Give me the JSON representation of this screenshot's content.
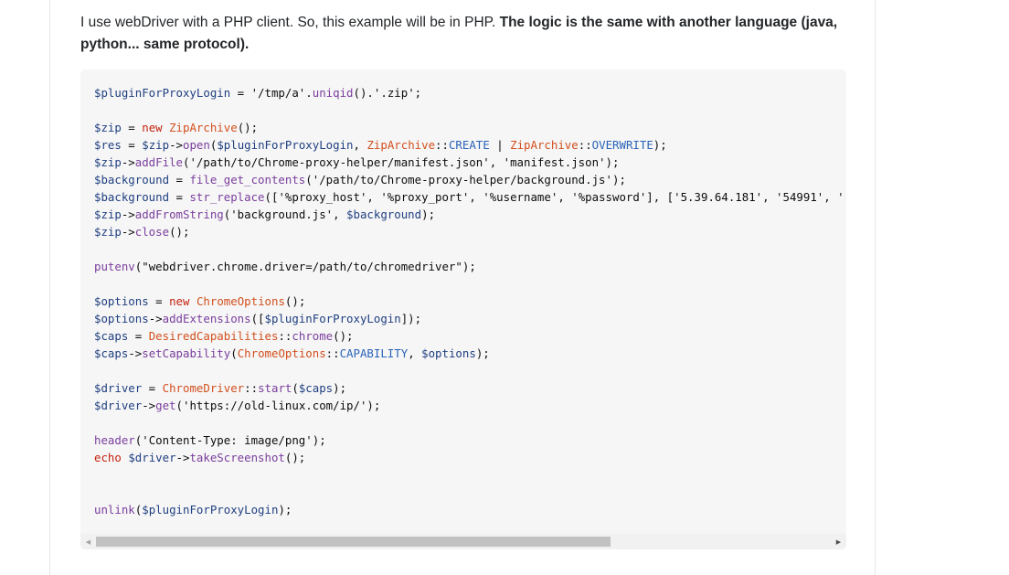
{
  "intro": {
    "plain": "I use webDriver with a PHP client. So, this example will be in PHP. ",
    "bold": "The logic is the same with another language (java, python... same protocol)."
  },
  "code": {
    "language": "php",
    "lines": [
      [
        {
          "t": "var",
          "v": "$pluginForProxyLogin"
        },
        {
          "t": "op",
          "v": " = "
        },
        {
          "t": "str",
          "v": "'/tmp/a'"
        },
        {
          "t": "op",
          "v": "."
        },
        {
          "t": "fn",
          "v": "uniqid"
        },
        {
          "t": "op",
          "v": "()."
        },
        {
          "t": "str",
          "v": "'.zip'"
        },
        {
          "t": "op",
          "v": ";"
        }
      ],
      [],
      [
        {
          "t": "var",
          "v": "$zip"
        },
        {
          "t": "op",
          "v": " = "
        },
        {
          "t": "kw",
          "v": "new"
        },
        {
          "t": "op",
          "v": " "
        },
        {
          "t": "cls",
          "v": "ZipArchive"
        },
        {
          "t": "op",
          "v": "();"
        }
      ],
      [
        {
          "t": "var",
          "v": "$res"
        },
        {
          "t": "op",
          "v": " = "
        },
        {
          "t": "var",
          "v": "$zip"
        },
        {
          "t": "op",
          "v": "->"
        },
        {
          "t": "fn",
          "v": "open"
        },
        {
          "t": "op",
          "v": "("
        },
        {
          "t": "var",
          "v": "$pluginForProxyLogin"
        },
        {
          "t": "op",
          "v": ", "
        },
        {
          "t": "cls",
          "v": "ZipArchive"
        },
        {
          "t": "op",
          "v": "::"
        },
        {
          "t": "const",
          "v": "CREATE"
        },
        {
          "t": "op",
          "v": " | "
        },
        {
          "t": "cls",
          "v": "ZipArchive"
        },
        {
          "t": "op",
          "v": "::"
        },
        {
          "t": "const",
          "v": "OVERWRITE"
        },
        {
          "t": "op",
          "v": ");"
        }
      ],
      [
        {
          "t": "var",
          "v": "$zip"
        },
        {
          "t": "op",
          "v": "->"
        },
        {
          "t": "fn",
          "v": "addFile"
        },
        {
          "t": "op",
          "v": "("
        },
        {
          "t": "str",
          "v": "'/path/to/Chrome-proxy-helper/manifest.json'"
        },
        {
          "t": "op",
          "v": ", "
        },
        {
          "t": "str",
          "v": "'manifest.json'"
        },
        {
          "t": "op",
          "v": ");"
        }
      ],
      [
        {
          "t": "var",
          "v": "$background"
        },
        {
          "t": "op",
          "v": " = "
        },
        {
          "t": "fn",
          "v": "file_get_contents"
        },
        {
          "t": "op",
          "v": "("
        },
        {
          "t": "str",
          "v": "'/path/to/Chrome-proxy-helper/background.js'"
        },
        {
          "t": "op",
          "v": ");"
        }
      ],
      [
        {
          "t": "var",
          "v": "$background"
        },
        {
          "t": "op",
          "v": " = "
        },
        {
          "t": "fn",
          "v": "str_replace"
        },
        {
          "t": "op",
          "v": "(["
        },
        {
          "t": "str",
          "v": "'%proxy_host'"
        },
        {
          "t": "op",
          "v": ", "
        },
        {
          "t": "str",
          "v": "'%proxy_port'"
        },
        {
          "t": "op",
          "v": ", "
        },
        {
          "t": "str",
          "v": "'%username'"
        },
        {
          "t": "op",
          "v": ", "
        },
        {
          "t": "str",
          "v": "'%password'"
        },
        {
          "t": "op",
          "v": "], ["
        },
        {
          "t": "str",
          "v": "'5.39.64.181'"
        },
        {
          "t": "op",
          "v": ", "
        },
        {
          "t": "str",
          "v": "'54991'"
        },
        {
          "t": "op",
          "v": ", '"
        }
      ],
      [
        {
          "t": "var",
          "v": "$zip"
        },
        {
          "t": "op",
          "v": "->"
        },
        {
          "t": "fn",
          "v": "addFromString"
        },
        {
          "t": "op",
          "v": "("
        },
        {
          "t": "str",
          "v": "'background.js'"
        },
        {
          "t": "op",
          "v": ", "
        },
        {
          "t": "var",
          "v": "$background"
        },
        {
          "t": "op",
          "v": ");"
        }
      ],
      [
        {
          "t": "var",
          "v": "$zip"
        },
        {
          "t": "op",
          "v": "->"
        },
        {
          "t": "fn",
          "v": "close"
        },
        {
          "t": "op",
          "v": "();"
        }
      ],
      [],
      [
        {
          "t": "fn",
          "v": "putenv"
        },
        {
          "t": "op",
          "v": "("
        },
        {
          "t": "str",
          "v": "\"webdriver.chrome.driver=/path/to/chromedriver\""
        },
        {
          "t": "op",
          "v": ");"
        }
      ],
      [],
      [
        {
          "t": "var",
          "v": "$options"
        },
        {
          "t": "op",
          "v": " = "
        },
        {
          "t": "kw",
          "v": "new"
        },
        {
          "t": "op",
          "v": " "
        },
        {
          "t": "cls",
          "v": "ChromeOptions"
        },
        {
          "t": "op",
          "v": "();"
        }
      ],
      [
        {
          "t": "var",
          "v": "$options"
        },
        {
          "t": "op",
          "v": "->"
        },
        {
          "t": "fn",
          "v": "addExtensions"
        },
        {
          "t": "op",
          "v": "(["
        },
        {
          "t": "var",
          "v": "$pluginForProxyLogin"
        },
        {
          "t": "op",
          "v": "]);"
        }
      ],
      [
        {
          "t": "var",
          "v": "$caps"
        },
        {
          "t": "op",
          "v": " = "
        },
        {
          "t": "cls",
          "v": "DesiredCapabilities"
        },
        {
          "t": "op",
          "v": "::"
        },
        {
          "t": "fn",
          "v": "chrome"
        },
        {
          "t": "op",
          "v": "();"
        }
      ],
      [
        {
          "t": "var",
          "v": "$caps"
        },
        {
          "t": "op",
          "v": "->"
        },
        {
          "t": "fn",
          "v": "setCapability"
        },
        {
          "t": "op",
          "v": "("
        },
        {
          "t": "cls",
          "v": "ChromeOptions"
        },
        {
          "t": "op",
          "v": "::"
        },
        {
          "t": "const",
          "v": "CAPABILITY"
        },
        {
          "t": "op",
          "v": ", "
        },
        {
          "t": "var",
          "v": "$options"
        },
        {
          "t": "op",
          "v": ");"
        }
      ],
      [],
      [
        {
          "t": "var",
          "v": "$driver"
        },
        {
          "t": "op",
          "v": " = "
        },
        {
          "t": "cls",
          "v": "ChromeDriver"
        },
        {
          "t": "op",
          "v": "::"
        },
        {
          "t": "fn",
          "v": "start"
        },
        {
          "t": "op",
          "v": "("
        },
        {
          "t": "var",
          "v": "$caps"
        },
        {
          "t": "op",
          "v": ");"
        }
      ],
      [
        {
          "t": "var",
          "v": "$driver"
        },
        {
          "t": "op",
          "v": "->"
        },
        {
          "t": "fn",
          "v": "get"
        },
        {
          "t": "op",
          "v": "("
        },
        {
          "t": "str",
          "v": "'https://old-linux.com/ip/'"
        },
        {
          "t": "op",
          "v": ");"
        }
      ],
      [],
      [
        {
          "t": "fn",
          "v": "header"
        },
        {
          "t": "op",
          "v": "("
        },
        {
          "t": "str",
          "v": "'Content-Type: image/png'"
        },
        {
          "t": "op",
          "v": ");"
        }
      ],
      [
        {
          "t": "kw",
          "v": "echo"
        },
        {
          "t": "op",
          "v": " "
        },
        {
          "t": "var",
          "v": "$driver"
        },
        {
          "t": "op",
          "v": "->"
        },
        {
          "t": "fn",
          "v": "takeScreenshot"
        },
        {
          "t": "op",
          "v": "();"
        }
      ],
      [],
      [],
      [
        {
          "t": "fn",
          "v": "unlink"
        },
        {
          "t": "op",
          "v": "("
        },
        {
          "t": "var",
          "v": "$pluginForProxyLogin"
        },
        {
          "t": "op",
          "v": ");"
        }
      ]
    ]
  },
  "scrollbar": {
    "left_arrow": "◀",
    "right_arrow": "▶",
    "visible_fraction": 0.7,
    "scroll_position": 0
  },
  "colors": {
    "code_background": "#f6f6f6",
    "variable": "#1f3f80",
    "function": "#7a3e9d",
    "keyword": "#c5220f",
    "class": "#d2501e",
    "constant": "#2a63b8",
    "text": "#232629"
  }
}
